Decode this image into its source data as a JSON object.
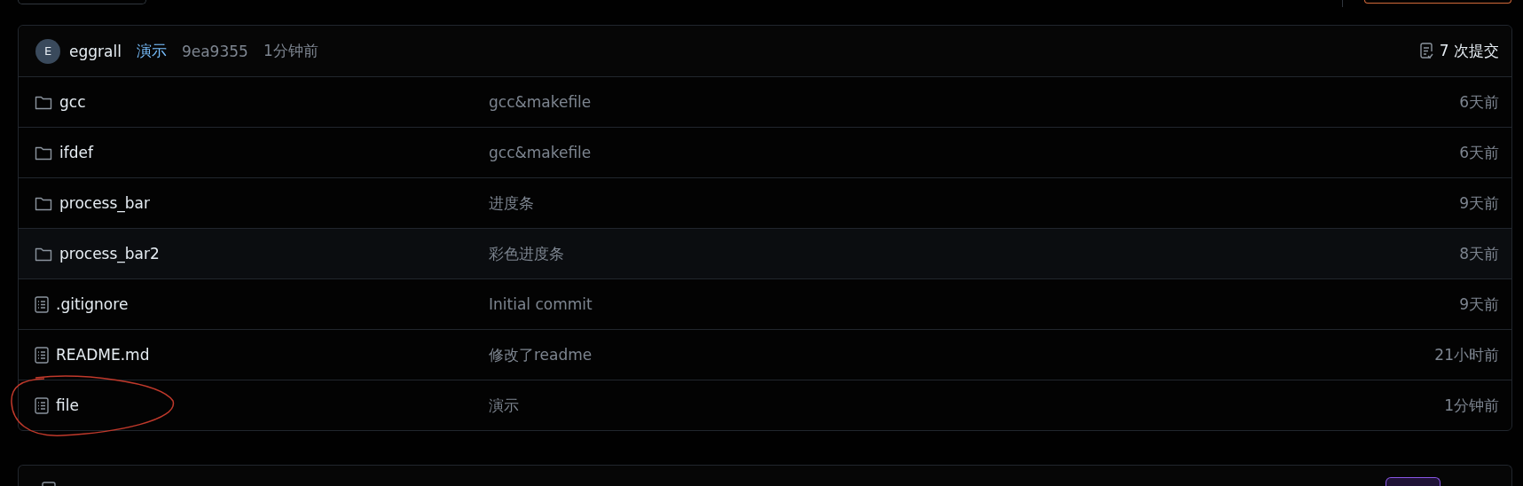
{
  "commit": {
    "avatar": "E",
    "author": "eggrall",
    "message": "演示",
    "hash": "9ea9355",
    "time": "1分钟前",
    "count": "7 次提交"
  },
  "files": [
    {
      "kind": "folder",
      "name": "gcc",
      "message": "gcc&makefile",
      "time": "6天前",
      "highlighted": false,
      "circled": false
    },
    {
      "kind": "folder",
      "name": "ifdef",
      "message": "gcc&makefile",
      "time": "6天前",
      "highlighted": false,
      "circled": false
    },
    {
      "kind": "folder",
      "name": "process_bar",
      "message": "进度条",
      "time": "9天前",
      "highlighted": false,
      "circled": false
    },
    {
      "kind": "folder",
      "name": "process_bar2",
      "message": "彩色进度条",
      "time": "8天前",
      "highlighted": true,
      "circled": false
    },
    {
      "kind": "file",
      "name": ".gitignore",
      "message": "Initial commit",
      "time": "9天前",
      "highlighted": false,
      "circled": false
    },
    {
      "kind": "file",
      "name": "README.md",
      "message": "修改了readme",
      "time": "21小时前",
      "highlighted": false,
      "circled": false
    },
    {
      "kind": "file",
      "name": "file",
      "message": "演示",
      "time": "1分钟前",
      "highlighted": false,
      "circled": true
    }
  ]
}
